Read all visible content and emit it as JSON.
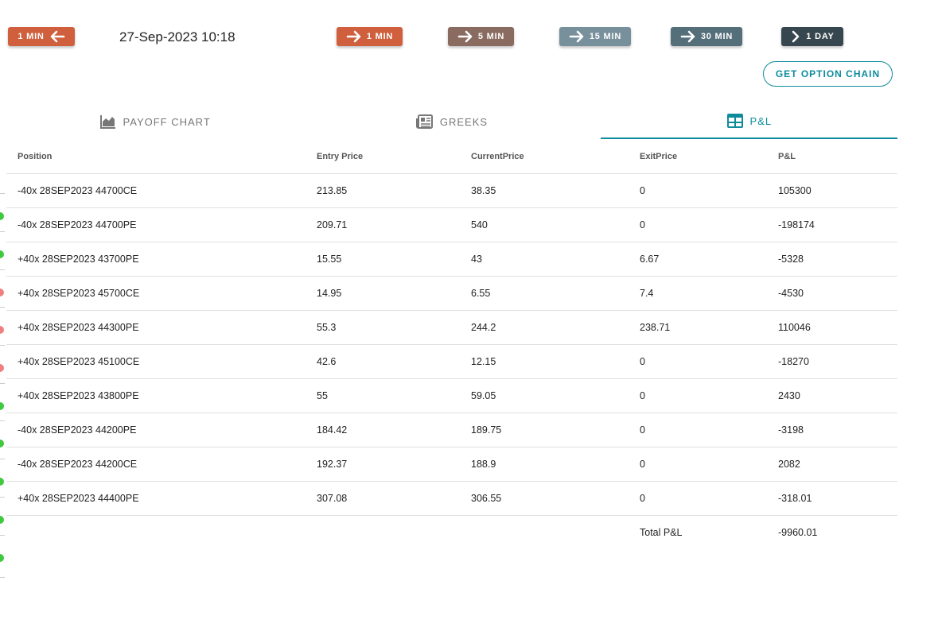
{
  "header": {
    "back_button": {
      "label": "1 MIN",
      "color": "#cf5f3d"
    },
    "datetime": "27-Sep-2023 10:18",
    "interval_buttons": [
      {
        "label": "1 MIN",
        "color": "#cf5f3d",
        "icon": "arrow-right-icon"
      },
      {
        "label": "5 MIN",
        "color": "#8a6b5f",
        "icon": "arrow-right-icon"
      },
      {
        "label": "15 MIN",
        "color": "#78909c",
        "icon": "arrow-right-icon"
      },
      {
        "label": "30 MIN",
        "color": "#546e7a",
        "icon": "arrow-right-icon"
      },
      {
        "label": "1 DAY",
        "color": "#37474f",
        "icon": "chevron-right-icon"
      }
    ],
    "option_chain_label": "GET OPTION CHAIN"
  },
  "tabs": [
    {
      "label": "PAYOFF CHART",
      "icon": "area-chart-icon",
      "active": false
    },
    {
      "label": "GREEKS",
      "icon": "newspaper-icon",
      "active": false
    },
    {
      "label": "P&L",
      "icon": "table-icon",
      "active": true
    }
  ],
  "accent_color": "#0e8c9c",
  "table": {
    "columns": [
      "Position",
      "Entry Price",
      "CurrentPrice",
      "ExitPrice",
      "P&L"
    ],
    "rows": [
      [
        "-40x 28SEP2023 44700CE",
        "213.85",
        "38.35",
        "0",
        "105300"
      ],
      [
        "-40x 28SEP2023 44700PE",
        "209.71",
        "540",
        "0",
        "-198174"
      ],
      [
        "+40x 28SEP2023 43700PE",
        "15.55",
        "43",
        "6.67",
        "-5328"
      ],
      [
        "+40x 28SEP2023 45700CE",
        "14.95",
        "6.55",
        "7.4",
        "-4530"
      ],
      [
        "+40x 28SEP2023 44300PE",
        "55.3",
        "244.2",
        "238.71",
        "110046"
      ],
      [
        "+40x 28SEP2023 45100CE",
        "42.6",
        "12.15",
        "0",
        "-18270"
      ],
      [
        "+40x 28SEP2023 43800PE",
        "55",
        "59.05",
        "0",
        "2430"
      ],
      [
        "-40x 28SEP2023 44200PE",
        "184.42",
        "189.75",
        "0",
        "-3198"
      ],
      [
        "-40x 28SEP2023 44200CE",
        "192.37",
        "188.9",
        "0",
        "2082"
      ],
      [
        "+40x 28SEP2023 44400PE",
        "307.08",
        "306.55",
        "0",
        "-318.01"
      ]
    ],
    "total_label": "Total P&L",
    "total_value": "-9960.01"
  },
  "edge_markers": [
    "#3ec93e",
    "#3ec93e",
    "#f08080",
    "#f08080",
    "#f08080",
    "#3ec93e",
    "#3ec93e",
    "#3ec93e",
    "#3ec93e",
    "#3ec93e"
  ]
}
